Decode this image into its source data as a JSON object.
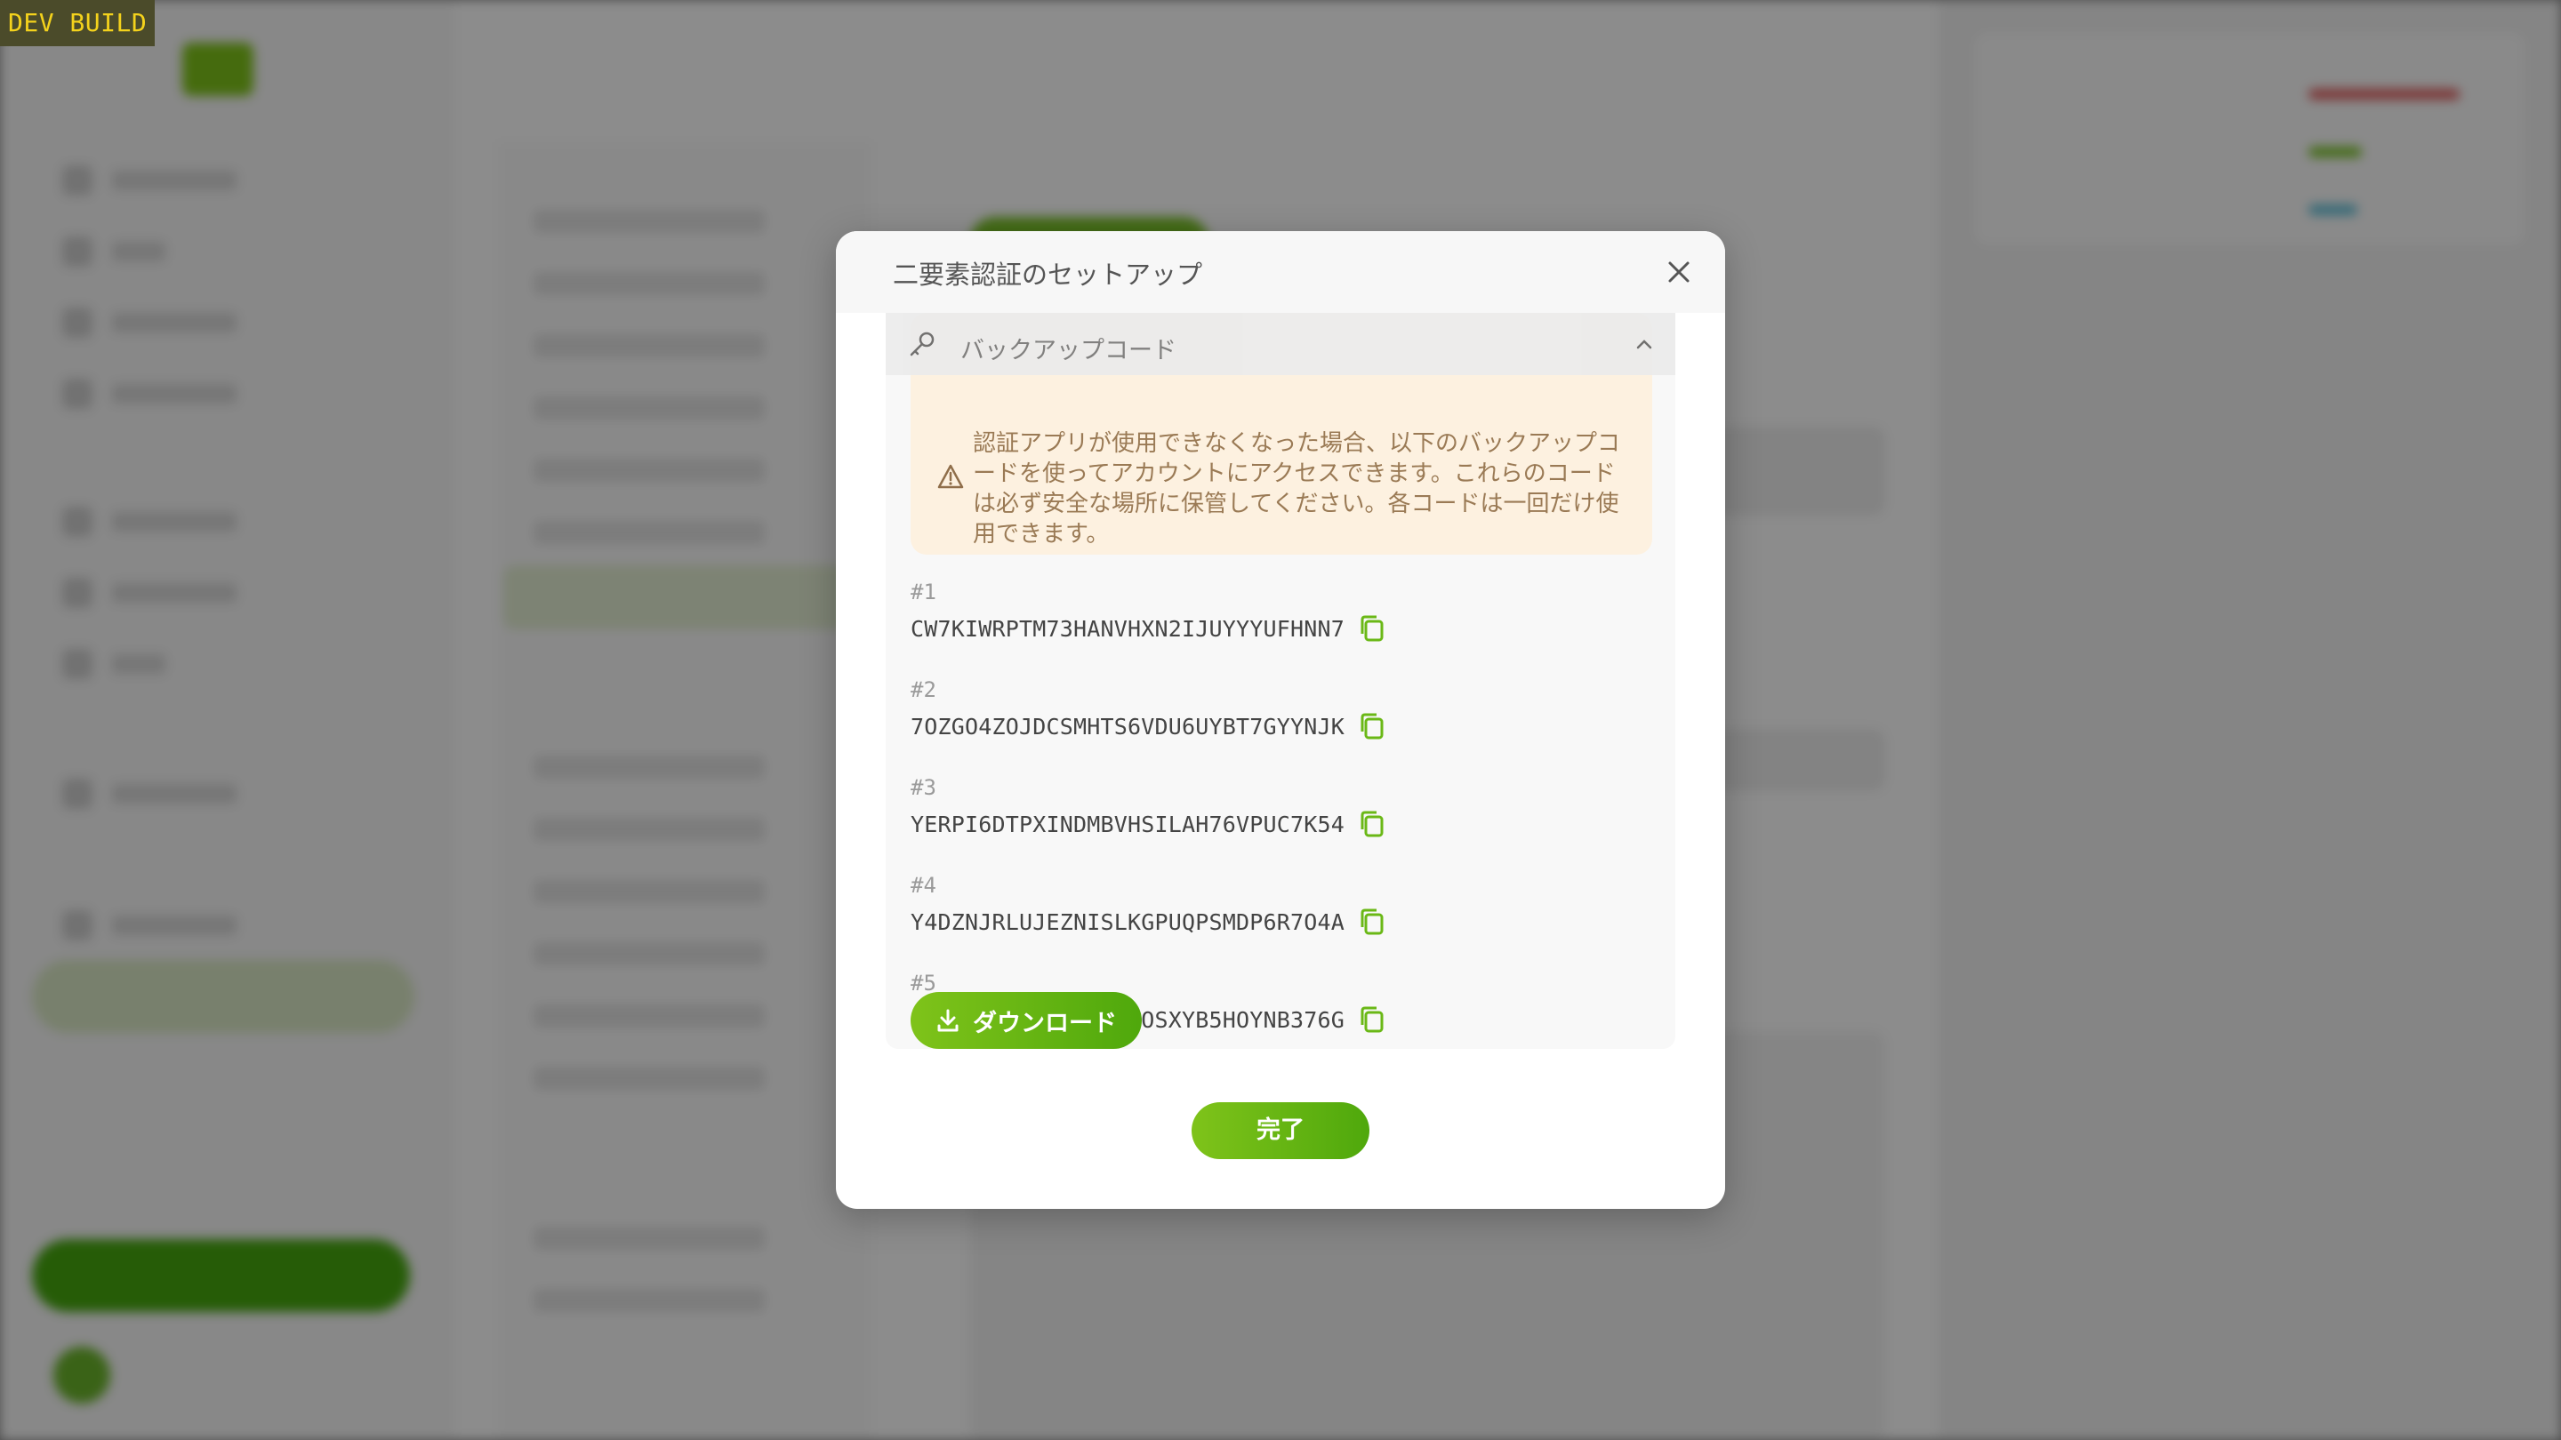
{
  "dev_badge": "DEV BUILD",
  "modal": {
    "title": "二要素認証のセットアップ",
    "close_icon": "close-icon",
    "section_label": "バックアップコード",
    "warning_text": "認証アプリが使用できなくなった場合、以下のバックアップコードを使ってアカウントにアクセスできます。これらのコードは必ず安全な場所に保管してください。各コードは一回だけ使用できます。",
    "codes": [
      {
        "num": "#1",
        "code": "CW7KIWRPTM73HANVHXN2IJUYYYUFHNN7"
      },
      {
        "num": "#2",
        "code": "7OZGO4ZOJDCSMHTS6VDU6UYBT7GYYNJK"
      },
      {
        "num": "#3",
        "code": "YERPI6DTPXINDMBVHSILAH76VPUC7K54"
      },
      {
        "num": "#4",
        "code": "Y4DZNJRLUJEZNISLKGPUQPSMDP6R7O4A"
      },
      {
        "num": "#5",
        "code": "JZR46VH25Y2R237F2OSXYB5HOYNB376G"
      }
    ],
    "download_label": "ダウンロード",
    "done_label": "完了"
  },
  "colors": {
    "accent": "#6ab816",
    "warning_bg": "#fdf1e0",
    "warning_text": "#9a7a55",
    "dev_badge_text": "#f4d21c"
  }
}
